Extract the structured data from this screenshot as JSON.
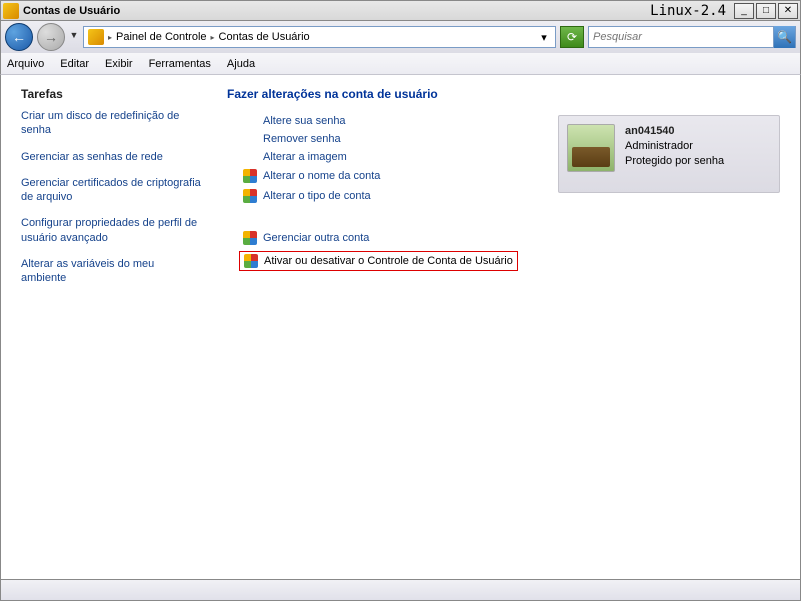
{
  "window": {
    "title": "Contas de Usuário",
    "vm": "Linux-2.4"
  },
  "breadcrumb": {
    "item1": "Painel de Controle",
    "item2": "Contas de Usuário"
  },
  "search": {
    "placeholder": "Pesquisar"
  },
  "menus": {
    "file": "Arquivo",
    "edit": "Editar",
    "view": "Exibir",
    "tools": "Ferramentas",
    "help": "Ajuda"
  },
  "tasks": {
    "heading": "Tarefas",
    "items": [
      "Criar um disco de redefinição de senha",
      "Gerenciar as senhas de rede",
      "Gerenciar certificados de criptografia de arquivo",
      "Configurar propriedades de perfil de usuário avançado",
      "Alterar as variáveis do meu ambiente"
    ]
  },
  "main": {
    "heading": "Fazer alterações na conta de usuário",
    "actions": {
      "change_password": "Altere sua senha",
      "remove_password": "Remover senha",
      "change_picture": "Alterar a imagem",
      "change_name": "Alterar o nome da conta",
      "change_type": "Alterar o tipo de conta",
      "manage_other": "Gerenciar outra conta",
      "uac": "Ativar ou desativar o Controle de Conta de Usuário"
    }
  },
  "user": {
    "name": "an041540",
    "role": "Administrador",
    "protection": "Protegido por senha"
  }
}
